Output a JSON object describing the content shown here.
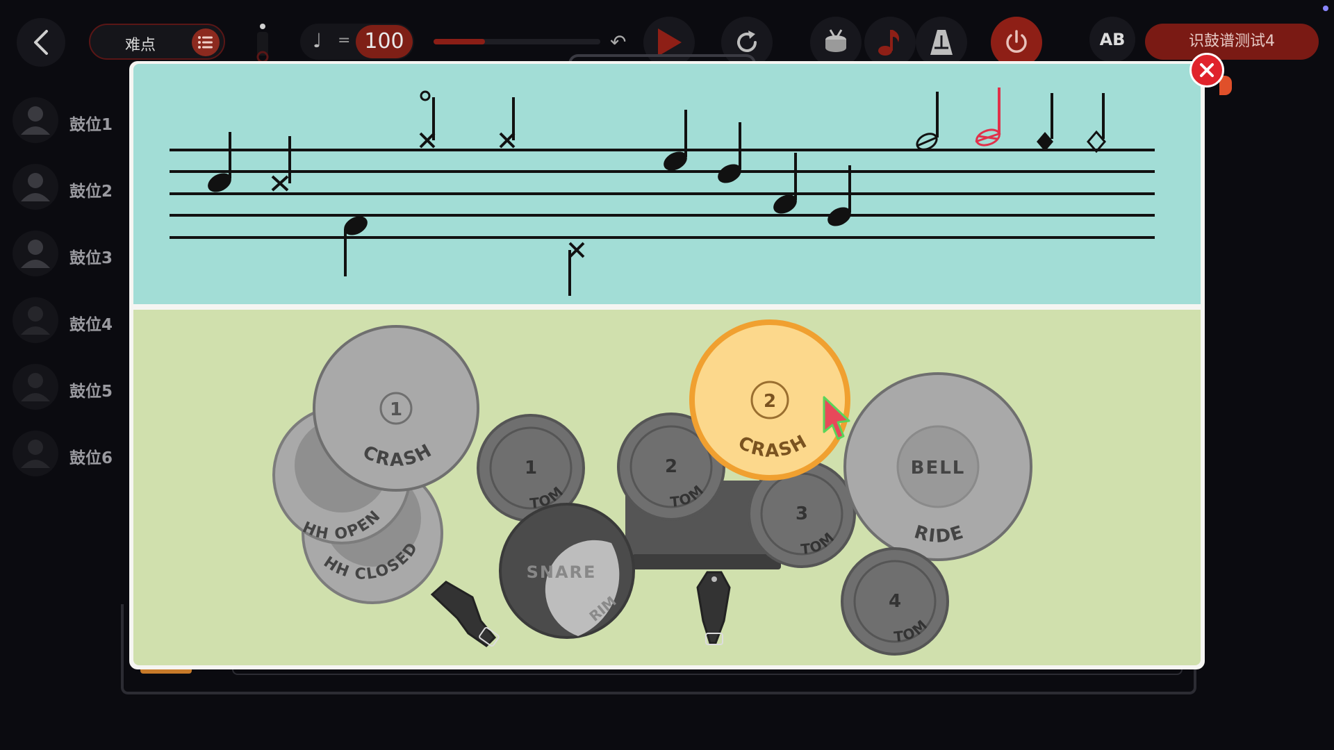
{
  "topbar": {
    "difficulty_label": "难点",
    "tempo_value": "100",
    "tempo_level": 0.31,
    "ab_label": "AB",
    "title": "识鼓谱测试4"
  },
  "sidebar": {
    "players": [
      {
        "label": "鼓位1"
      },
      {
        "label": "鼓位2"
      },
      {
        "label": "鼓位3"
      },
      {
        "label": "鼓位4"
      },
      {
        "label": "鼓位5"
      },
      {
        "label": "鼓位6"
      }
    ]
  },
  "drumkit": {
    "crash1": {
      "number": "1",
      "label": "CRASH"
    },
    "crash2": {
      "number": "2",
      "label": "CRASH"
    },
    "hh_open": {
      "label": "HH OPEN"
    },
    "hh_closed": {
      "label": "HH CLOSED"
    },
    "tom1": {
      "number": "1",
      "label": "TOM"
    },
    "tom2": {
      "number": "2",
      "label": "TOM"
    },
    "tom3": {
      "number": "3",
      "label": "TOM"
    },
    "tom4": {
      "number": "4",
      "label": "TOM"
    },
    "snare": {
      "label": "SNARE"
    },
    "rim": {
      "label": "RIM"
    },
    "bell": {
      "label": "BELL"
    },
    "ride": {
      "label": "RIDE"
    }
  },
  "colors": {
    "accent_red": "#7a1a14",
    "staff_bg": "#a2ddd6",
    "kit_bg": "#d0e0ad",
    "highlight": "#fcd88c",
    "highlight_ring": "#f0a030",
    "note_highlight": "#e0304a"
  },
  "icons": [
    "back-icon",
    "list-icon",
    "microphone-icon",
    "quarter-note-icon",
    "undo-icon",
    "play-icon",
    "refresh-icon",
    "drum-icon",
    "music-note-icon",
    "metronome-icon",
    "power-icon",
    "close-icon",
    "cursor-icon"
  ]
}
